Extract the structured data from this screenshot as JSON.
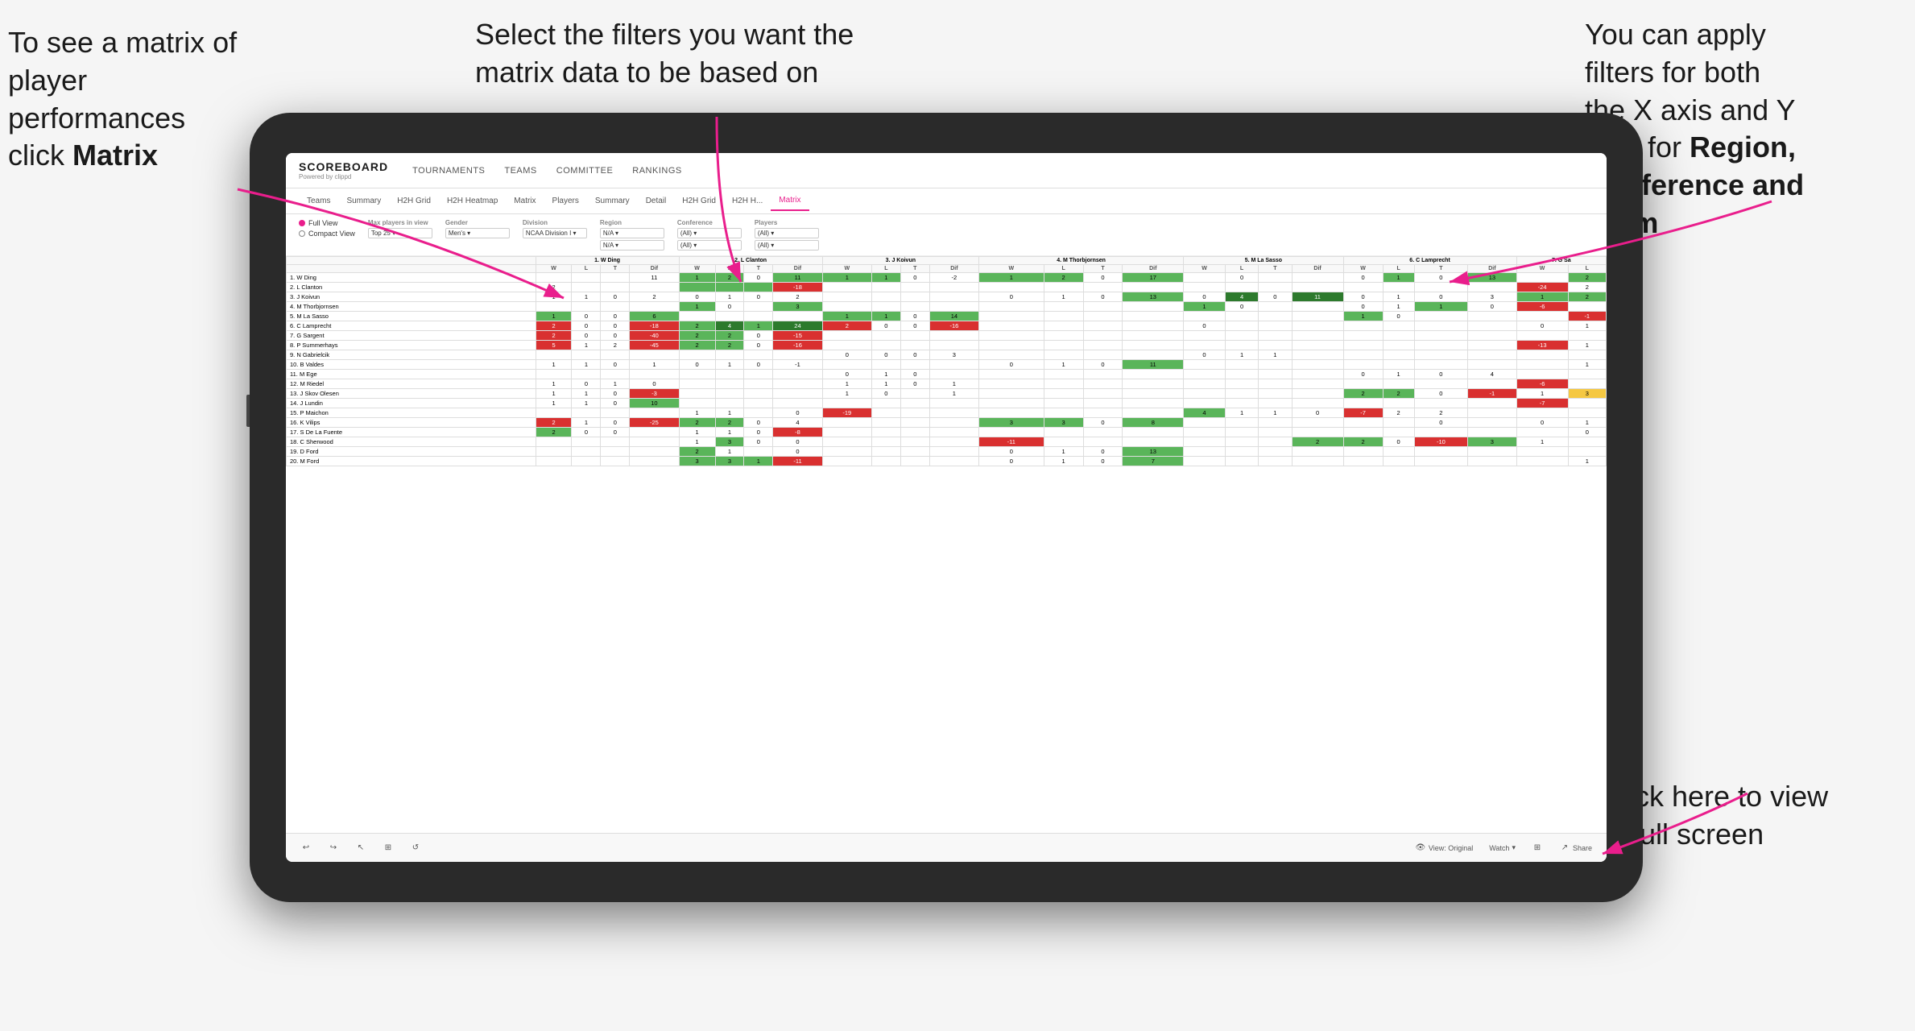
{
  "annotations": {
    "topleft": {
      "line1": "To see a matrix of",
      "line2": "player performances",
      "line3_normal": "click ",
      "line3_bold": "Matrix"
    },
    "topcenter": {
      "line1": "Select the filters you want the",
      "line2": "matrix data to be based on"
    },
    "topright": {
      "line1": "You  can apply",
      "line2": "filters for both",
      "line3": "the X axis and Y",
      "line4_normal": "Axis for ",
      "line4_bold": "Region,",
      "line5_bold": "Conference and",
      "line6_bold": "Team"
    },
    "bottomright": {
      "line1": "Click here to view",
      "line2": "in full screen"
    }
  },
  "app": {
    "logo": "SCOREBOARD",
    "logo_sub": "Powered by clippd",
    "nav_items": [
      "TOURNAMENTS",
      "TEAMS",
      "COMMITTEE",
      "RANKINGS"
    ],
    "sub_nav": [
      "Teams",
      "Summary",
      "H2H Grid",
      "H2H Heatmap",
      "Matrix",
      "Players",
      "Summary",
      "Detail",
      "H2H Grid",
      "H2H H...",
      "Matrix"
    ],
    "active_tab": "Matrix"
  },
  "filters": {
    "view_full": "Full View",
    "view_compact": "Compact View",
    "view_selected": "full",
    "max_players_label": "Max players in view",
    "max_players_value": "Top 25",
    "gender_label": "Gender",
    "gender_value": "Men's",
    "division_label": "Division",
    "division_value": "NCAA Division I",
    "region_label": "Region",
    "region_value": "N/A",
    "region_value2": "N/A",
    "conference_label": "Conference",
    "conference_value": "(All)",
    "conference_value2": "(All)",
    "players_label": "Players",
    "players_value": "(All)",
    "players_value2": "(All)"
  },
  "matrix": {
    "col_headers": [
      "1. W Ding",
      "2. L Clanton",
      "3. J Koivun",
      "4. M Thorbjornsen",
      "5. M La Sasso",
      "6. C Lamprecht",
      "7. G Sa"
    ],
    "sub_headers": [
      "W",
      "L",
      "T",
      "Dif"
    ],
    "rows": [
      {
        "name": "1. W Ding",
        "self_col": true,
        "cells": [
          {
            "v": "1",
            "c": "green"
          },
          {
            "v": "2",
            "c": "white"
          },
          {
            "v": "0",
            "c": "white"
          },
          {
            "v": "11",
            "c": "white"
          }
        ]
      },
      {
        "name": "2. L Clanton"
      },
      {
        "name": "3. J Koivun"
      },
      {
        "name": "4. M Thorbjornsen"
      },
      {
        "name": "5. M La Sasso"
      },
      {
        "name": "6. C Lamprecht"
      },
      {
        "name": "7. G Sargent"
      },
      {
        "name": "8. P Summerhays"
      },
      {
        "name": "9. N Gabrielcik"
      },
      {
        "name": "10. B Valdes"
      },
      {
        "name": "11. M Ege"
      },
      {
        "name": "12. M Riedel"
      },
      {
        "name": "13. J Skov Olesen"
      },
      {
        "name": "14. J Lundin"
      },
      {
        "name": "15. P Maichon"
      },
      {
        "name": "16. K Vilips"
      },
      {
        "name": "17. S De La Fuente"
      },
      {
        "name": "18. C Sherwood"
      },
      {
        "name": "19. D Ford"
      },
      {
        "name": "20. M Ford"
      }
    ]
  },
  "toolbar": {
    "view_label": "View: Original",
    "watch_label": "Watch",
    "share_label": "Share"
  }
}
